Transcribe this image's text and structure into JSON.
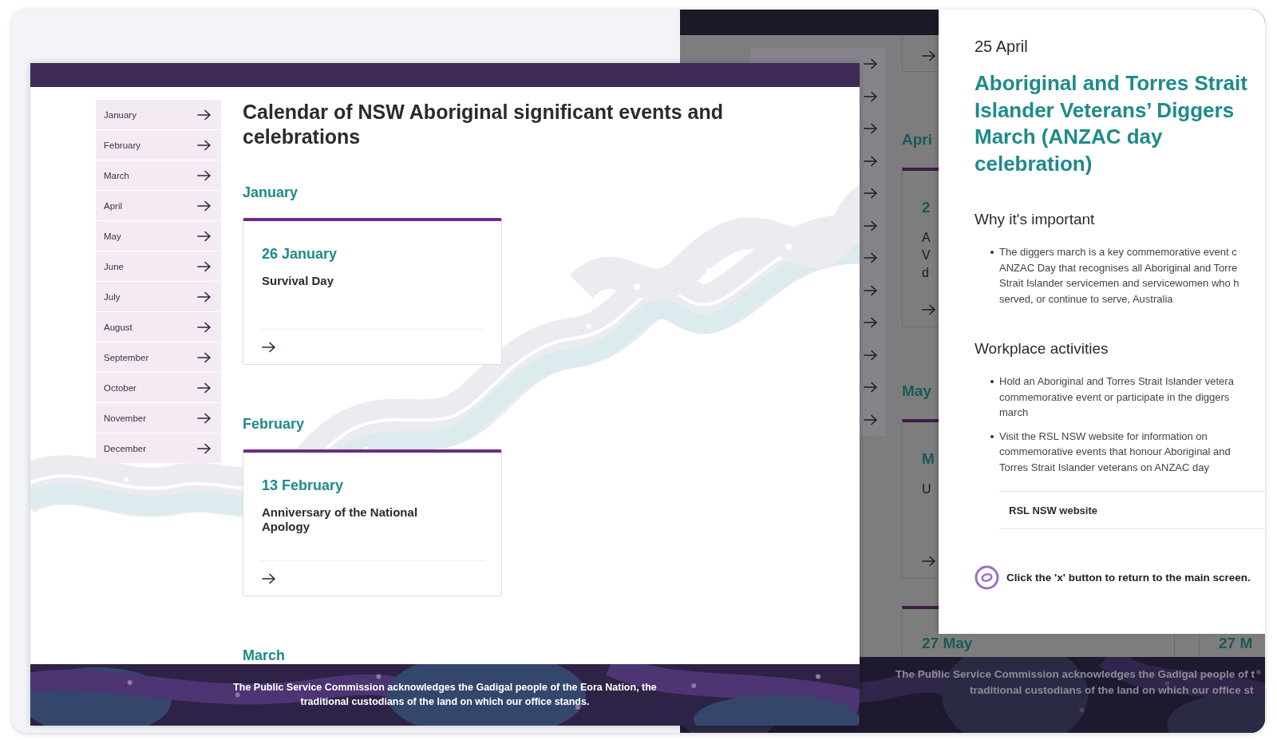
{
  "main_window": {
    "sidebar": {
      "items": [
        {
          "label": "January"
        },
        {
          "label": "February"
        },
        {
          "label": "March"
        },
        {
          "label": "April"
        },
        {
          "label": "May"
        },
        {
          "label": "June"
        },
        {
          "label": "July"
        },
        {
          "label": "August"
        },
        {
          "label": "September"
        },
        {
          "label": "October"
        },
        {
          "label": "November"
        },
        {
          "label": "December"
        }
      ]
    },
    "title": "Calendar of NSW Aboriginal significant events and celebrations",
    "sections": [
      {
        "heading": "January",
        "events": [
          {
            "date": "26 January",
            "title": "Survival Day"
          }
        ]
      },
      {
        "heading": "February",
        "events": [
          {
            "date": "13 February",
            "title": "Anniversary of the National Apology"
          }
        ]
      },
      {
        "heading": "March"
      }
    ],
    "footer": {
      "lines": [
        "The Public Service Commission acknowledges the Gadigal people of the Eora Nation, the",
        "traditional custodians of the land on which our office stands."
      ]
    }
  },
  "background_window": {
    "sections": [
      {
        "heading": "Apri",
        "events": [
          {
            "date": "2",
            "title_lines": [
              "A",
              "V",
              "d"
            ]
          }
        ]
      },
      {
        "heading": "May",
        "events": [
          {
            "date": "M",
            "title_lines": [
              "U"
            ]
          }
        ]
      },
      {
        "events": [
          {
            "date": "27 May"
          },
          {
            "date": "27 M"
          }
        ]
      }
    ],
    "footer": {
      "lines": [
        "The Public Service Commission acknowledges the Gadigal people of t",
        "traditional custodians of the land on which our office st"
      ]
    }
  },
  "detail_panel": {
    "date": "25 April",
    "title_lines": [
      "Aboriginal and Torres Strait",
      "Islander Veterans’ Diggers",
      "March (ANZAC day",
      "celebration)"
    ],
    "sections": [
      {
        "heading": "Why it's important",
        "bullets": [
          [
            "The diggers march is a key commemorative event c",
            "ANZAC Day that recognises all Aboriginal and Torre",
            "Strait Islander servicemen and servicewomen who h",
            "served, or continue to serve, Australia"
          ]
        ]
      },
      {
        "heading": "Workplace activities",
        "bullets": [
          [
            "Hold an Aboriginal and Torres Strait Islander vetera",
            "commemorative event or participate in the diggers",
            "march"
          ],
          [
            "Visit the RSL NSW website for information on",
            "commemorative events that honour Aboriginal and",
            "Torres Strait Islander veterans on ANZAC day"
          ]
        ],
        "link": "RSL NSW website"
      }
    ],
    "hint": "Click the 'x' button to return to the main screen."
  }
}
